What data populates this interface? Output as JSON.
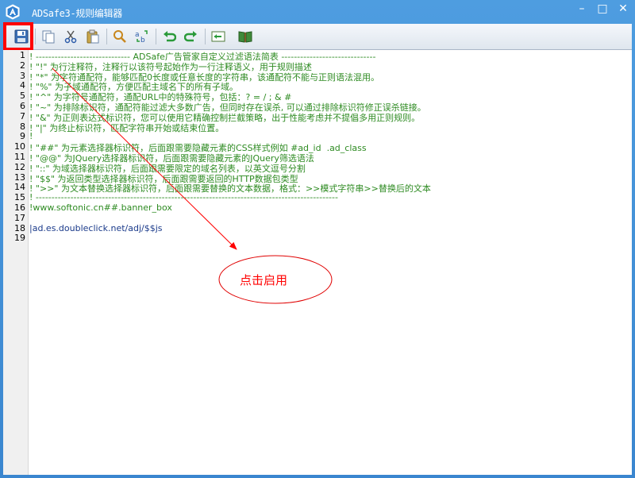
{
  "window": {
    "title": "ADSafe3-规则编辑器",
    "minimize_glyph": "–",
    "maximize_glyph": "□",
    "close_glyph": "✕"
  },
  "toolbar": {
    "buttons": [
      "save-icon",
      "copy-icon",
      "cut-icon",
      "paste-icon",
      "find-icon",
      "replace-icon",
      "undo-icon",
      "redo-icon",
      "import-icon",
      "book-icon"
    ]
  },
  "editor": {
    "line_numbers": [
      "1",
      "2",
      "3",
      "4",
      "5",
      "6",
      "7",
      "8",
      "9",
      "10",
      "11",
      "12",
      "13",
      "14",
      "15",
      "16",
      "17",
      "18",
      "19"
    ],
    "lines": [
      "! ------------------------------ ADSafe广告管家自定义过滤语法简表 ------------------------------",
      "! \"!\" 为行注释符，注释行以该符号起始作为一行注释语义，用于规则描述",
      "! \"*\" 为字符通配符，能够匹配0长度或任意长度的字符串，该通配符不能与正则语法混用。",
      "! \"%\" 为子域通配符，方便匹配主域名下的所有子域。",
      "! \"^\" 为字符号通配符，通配URL中的特殊符号，包括：? = / ; & #",
      "! \"~\" 为排除标识符，通配符能过滤大多数广告，但同时存在误杀, 可以通过排除标识符修正误杀链接。",
      "! \"&\" 为正则表达式标识符，您可以使用它精确控制拦截策略，出于性能考虑并不提倡多用正则规则。",
      "! \"|\" 为终止标识符，匹配字符串开始或结束位置。",
      "!",
      "! \"##\" 为元素选择器标识符，后面跟需要隐藏元素的CSS样式例如 #ad_id  .ad_class",
      "! \"@@\" 为JQuery选择器标识符，后面跟需要隐藏元素的JQuery筛选语法",
      "! \"::\" 为域选择器标识符，后面跟需要限定的域名列表，以英文逗号分割",
      "! \"$$\" 为返回类型选择器标识符，后面跟需要返回的HTTP数据包类型",
      "! \">>\" 为文本替换选择器标识符，后面跟需要替换的文本数据，格式：>>模式字符串>>替换后的文本",
      "! ------------------------------------------------------------------------------------------------",
      "!www.softonic.cn##.banner_box",
      "",
      "|ad.es.doubleclick.net/adj/$$js",
      ""
    ]
  },
  "annotation": {
    "text": "点击启用",
    "color": "#ff0000"
  }
}
